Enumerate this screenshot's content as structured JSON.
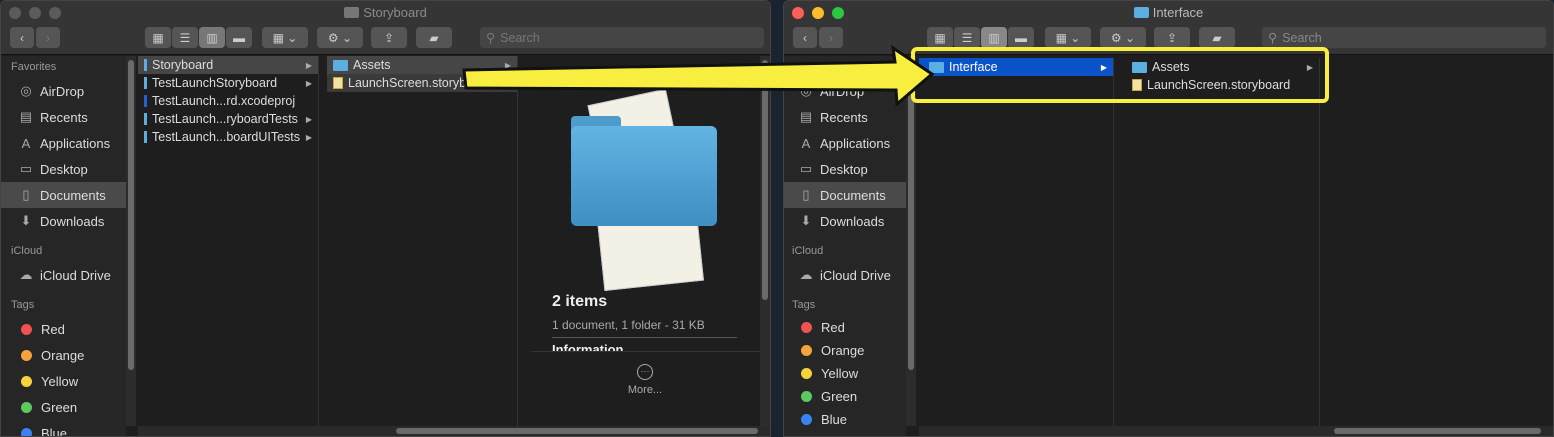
{
  "left_window": {
    "title": "Storyboard",
    "search_placeholder": "Search",
    "sidebar": {
      "favorites_header": "Favorites",
      "favorites": [
        {
          "label": "AirDrop",
          "icon": "airdrop-icon"
        },
        {
          "label": "Recents",
          "icon": "recents-icon"
        },
        {
          "label": "Applications",
          "icon": "applications-icon"
        },
        {
          "label": "Desktop",
          "icon": "desktop-icon"
        },
        {
          "label": "Documents",
          "icon": "documents-icon",
          "selected": true
        },
        {
          "label": "Downloads",
          "icon": "downloads-icon"
        }
      ],
      "icloud_header": "iCloud",
      "icloud": [
        {
          "label": "iCloud Drive",
          "icon": "cloud-icon"
        }
      ],
      "tags_header": "Tags",
      "tags": [
        {
          "label": "Red",
          "color": "#f0524f"
        },
        {
          "label": "Orange",
          "color": "#f5a33a"
        },
        {
          "label": "Yellow",
          "color": "#f6d33b"
        },
        {
          "label": "Green",
          "color": "#5ccb5f"
        },
        {
          "label": "Blue",
          "color": "#3b82f6"
        }
      ]
    },
    "column1": [
      {
        "label": "Storyboard",
        "arrow": true
      },
      {
        "label": "TestLaunchStoryboard",
        "arrow": true
      },
      {
        "label": "TestLaunch...rd.xcodeproj",
        "arrow": false
      },
      {
        "label": "TestLaunch...ryboardTests",
        "arrow": true
      },
      {
        "label": "TestLaunch...boardUITests",
        "arrow": true
      }
    ],
    "column2": [
      {
        "label": "Assets",
        "type": "folder"
      },
      {
        "label": "LaunchScreen.storyboard",
        "type": "document"
      }
    ],
    "preview": {
      "title": "2 items",
      "subtitle": "1 document, 1 folder - 31 KB",
      "section": "Information",
      "more": "More..."
    }
  },
  "right_window": {
    "title": "Interface",
    "search_placeholder": "Search",
    "sidebar": {
      "favorites": [
        {
          "label": "AirDrop",
          "icon": "airdrop-icon"
        },
        {
          "label": "Recents",
          "icon": "recents-icon"
        },
        {
          "label": "Applications",
          "icon": "applications-icon"
        },
        {
          "label": "Desktop",
          "icon": "desktop-icon"
        },
        {
          "label": "Documents",
          "icon": "documents-icon",
          "selected": true
        },
        {
          "label": "Downloads",
          "icon": "downloads-icon"
        }
      ],
      "icloud_header": "iCloud",
      "icloud": [
        {
          "label": "iCloud Drive",
          "icon": "cloud-icon"
        }
      ],
      "tags_header": "Tags",
      "tags": [
        {
          "label": "Red",
          "color": "#f0524f"
        },
        {
          "label": "Orange",
          "color": "#f5a33a"
        },
        {
          "label": "Yellow",
          "color": "#f6d33b"
        },
        {
          "label": "Green",
          "color": "#5ccb5f"
        },
        {
          "label": "Blue",
          "color": "#3b82f6"
        }
      ]
    },
    "column1": [
      {
        "label": "Interface",
        "selected": true
      }
    ],
    "column2": [
      {
        "label": "Assets",
        "type": "folder"
      },
      {
        "label": "LaunchScreen.storyboard",
        "type": "document"
      }
    ]
  },
  "annotation": {
    "color": "#f7ee3f"
  }
}
